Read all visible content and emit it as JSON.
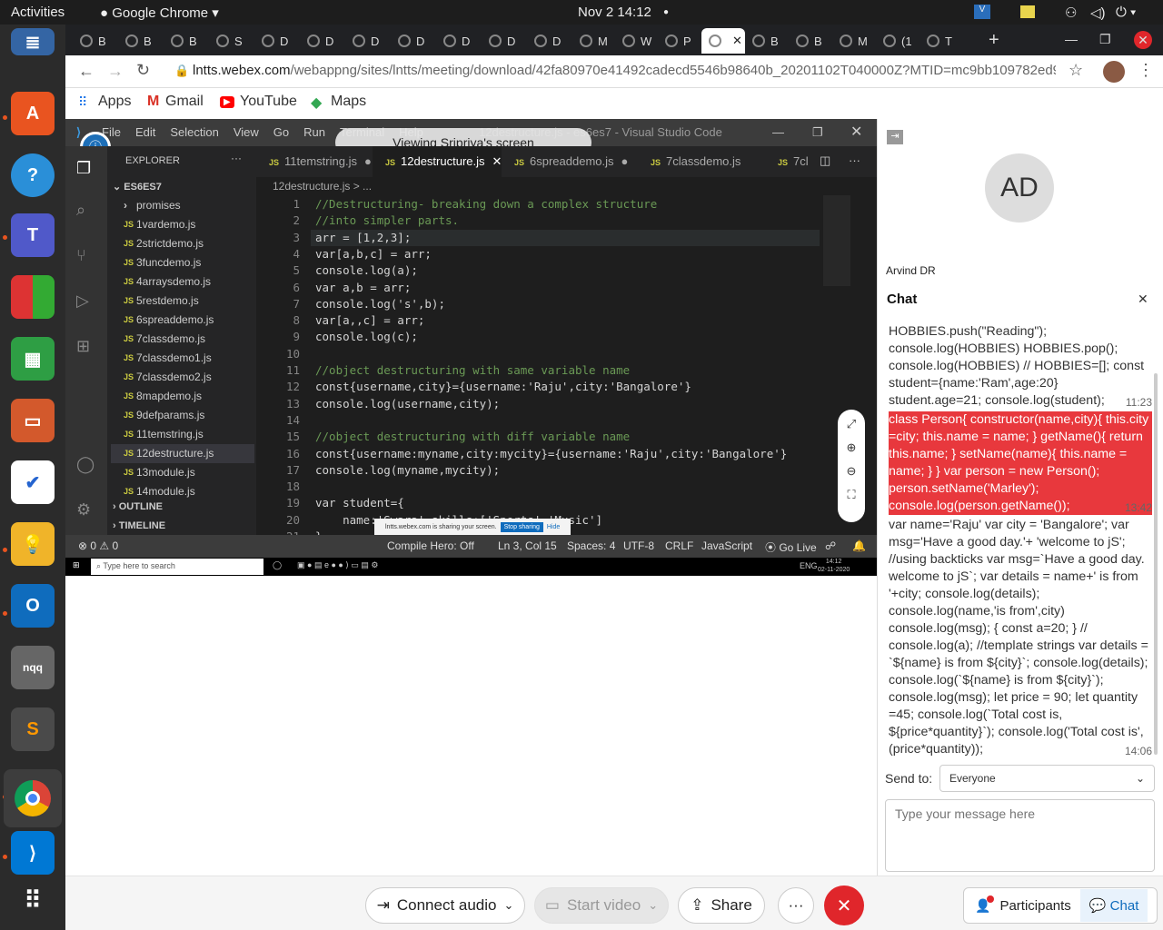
{
  "os": {
    "activities": "Activities",
    "app_name": "Google Chrome",
    "clock": "Nov 2  14:12"
  },
  "chrome": {
    "tabs": [
      "B",
      "B",
      "B",
      "S",
      "D",
      "D",
      "D",
      "D",
      "D",
      "D",
      "D",
      "M",
      "W",
      "P",
      "",
      "B",
      "B",
      "M",
      "(1",
      "T"
    ],
    "url_host": "lntts.webex.com",
    "url_path": "/webappng/sites/lntts/meeting/download/42fa80970e41492cadecd5546b98640b_20201102T040000Z?MTID=mc9bb109782ed96f...",
    "bookmarks": [
      "Apps",
      "Gmail",
      "YouTube",
      "Maps"
    ]
  },
  "share_banner": "Viewing Sripriya's screen",
  "vscode": {
    "menu": [
      "File",
      "Edit",
      "Selection",
      "View",
      "Go",
      "Run",
      "Terminal",
      "Help"
    ],
    "title": "12destructure.js - es6es7 - Visual Studio Code",
    "explorer_title": "EXPLORER",
    "folder": "ES6ES7",
    "files": [
      "promises",
      "1vardemo.js",
      "2strictdemo.js",
      "3funcdemo.js",
      "4arraysdemo.js",
      "5restdemo.js",
      "6spreaddemo.js",
      "7classdemo.js",
      "7classdemo1.js",
      "7classdemo2.js",
      "8mapdemo.js",
      "9defparams.js",
      "11temstring.js",
      "12destructure.js",
      "13module.js",
      "14module.js"
    ],
    "outline": "OUTLINE",
    "timeline": "TIMELINE",
    "editor_tabs": [
      "11temstring.js",
      "12destructure.js",
      "6spreaddemo.js",
      "7classdemo.js",
      "7cl"
    ],
    "breadcrumb": "12destructure.js > ...",
    "lines": [
      "//Destructuring- breaking down a complex structure",
      "//into simpler parts.",
      "arr = [1,2,3];",
      "var[a,b,c] = arr;",
      "console.log(a);",
      "var a,b = arr;",
      "console.log('s',b);",
      "var[a,,c] = arr;",
      "console.log(c);",
      "",
      "//object destructuring with same variable name",
      "const{username,city}={username:'Raju',city:'Bangalore'}",
      "console.log(username,city);",
      "",
      "//object destructuring with diff variable name",
      "const{username:myname,city:mycity}={username:'Raju',city:'Bangalore'}",
      "console.log(myname,mycity);",
      "",
      "var student={",
      "    name:'Swara',skills:['Sports','Music']",
      "}"
    ],
    "status": {
      "problems": "⊗ 0 ⚠ 0",
      "compile": "Compile Hero: Off",
      "position": "Ln 3, Col 15",
      "spaces": "Spaces: 4",
      "encoding": "UTF-8",
      "eol": "CRLF",
      "language": "JavaScript",
      "golive": "Go Live"
    },
    "sharing_notice": "lntts.webex.com is sharing your screen.",
    "stop_sharing": "Stop sharing",
    "hide": "Hide",
    "win_search": "Type here to search",
    "win_time": "14:12",
    "win_date": "02-11-2020",
    "win_lang": "ENG"
  },
  "participant": {
    "initials": "AD",
    "name": "Arvind DR"
  },
  "chat": {
    "title": "Chat",
    "messages": [
      {
        "text": "HOBBIES.push(\"Reading\"); console.log(HOBBIES) HOBBIES.pop(); console.log(HOBBIES) // HOBBIES=[]; const student={name:'Ram',age:20} student.age=21; console.log(student);",
        "time": "11:23",
        "highlight": false
      },
      {
        "text": "class Person{ constructor(name,city){ this.city =city; this.name = name; } getName(){ return this.name; } setName(name){ this.name = name; } } var person = new Person(); person.setName('Marley'); console.log(person.getName());",
        "time": "13:42",
        "highlight": true
      },
      {
        "text": "var name='Raju' var city = 'Bangalore'; var msg='Have a good day.'+ 'welcome to jS'; //using backticks var msg=`Have a good day. welcome to jS`; var details = name+' is from '+city; console.log(details); console.log(name,'is from',city) console.log(msg); { const a=20; } // console.log(a); //template strings var details = `${name} is from ${city}`; console.log(details); console.log(`${name} is from ${city}`); console.log(msg); let price = 90; let quantity =45; console.log(`Total cost is, ${price*quantity}`); console.log('Total cost is', (price*quantity));",
        "time": "14:06",
        "highlight": false
      }
    ],
    "send_to_label": "Send to:",
    "send_to_value": "Everyone",
    "input_placeholder": "Type your message here"
  },
  "controls": {
    "connect_audio": "Connect audio",
    "start_video": "Start video",
    "share": "Share",
    "more": "···",
    "participants": "Participants",
    "chat": "Chat"
  }
}
